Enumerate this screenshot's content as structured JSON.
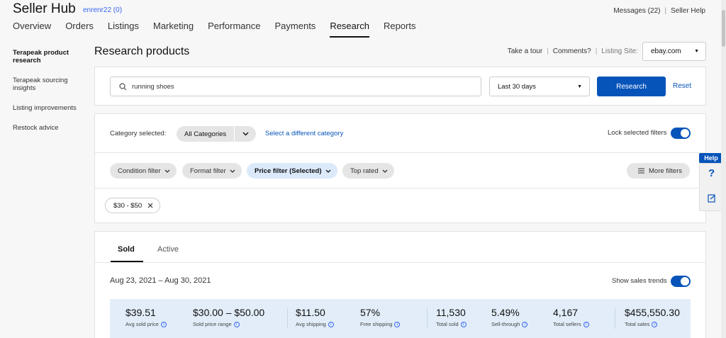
{
  "header": {
    "title": "Seller Hub",
    "user": "enrenr22 (0)",
    "messages": "Messages (22)",
    "help": "Seller Help"
  },
  "nav": {
    "tabs": [
      "Overview",
      "Orders",
      "Listings",
      "Marketing",
      "Performance",
      "Payments",
      "Research",
      "Reports"
    ],
    "active": "Research"
  },
  "sidebar": {
    "items": [
      "Terapeak product research",
      "Terapeak sourcing insights",
      "Listing improvements",
      "Restock advice"
    ]
  },
  "page": {
    "title": "Research products",
    "take_tour": "Take a tour",
    "comments": "Comments?",
    "listing_site_label": "Listing Site:",
    "listing_site_value": "ebay.com"
  },
  "search": {
    "query": "running shoes",
    "range": "Last 30 days",
    "research_label": "Research",
    "reset_label": "Reset"
  },
  "filters": {
    "category_label": "Category selected:",
    "category_value": "All Categories",
    "category_link": "Select a different category",
    "lock_label": "Lock selected filters",
    "chips": [
      "Condition filter",
      "Format filter",
      "Price filter (Selected)",
      "Top rated"
    ],
    "more": "More filters",
    "applied": "$30 - $50"
  },
  "results": {
    "tabs": [
      "Sold",
      "Active"
    ],
    "date_range": "Aug 23, 2021 – Aug 30, 2021",
    "trend_label": "Show sales trends",
    "stats": [
      {
        "value": "$39.51",
        "label": "Avg sold price"
      },
      {
        "value": "$30.00 – $50.00",
        "label": "Sold price range"
      },
      {
        "value": "$11.50",
        "label": "Avg shipping"
      },
      {
        "value": "57%",
        "label": "Free shipping"
      },
      {
        "value": "11,530",
        "label": "Total sold"
      },
      {
        "value": "5.49%",
        "label": "Sell-through"
      },
      {
        "value": "4,167",
        "label": "Total sellers"
      },
      {
        "value": "$455,550.30",
        "label": "Total sales"
      }
    ]
  },
  "help_widget": {
    "label": "Help",
    "q": "?"
  },
  "colors": {
    "primary": "#0654ba",
    "link": "#3665f3",
    "stats_bg": "#e2edf9",
    "chip_selected": "#dbe9fb"
  }
}
